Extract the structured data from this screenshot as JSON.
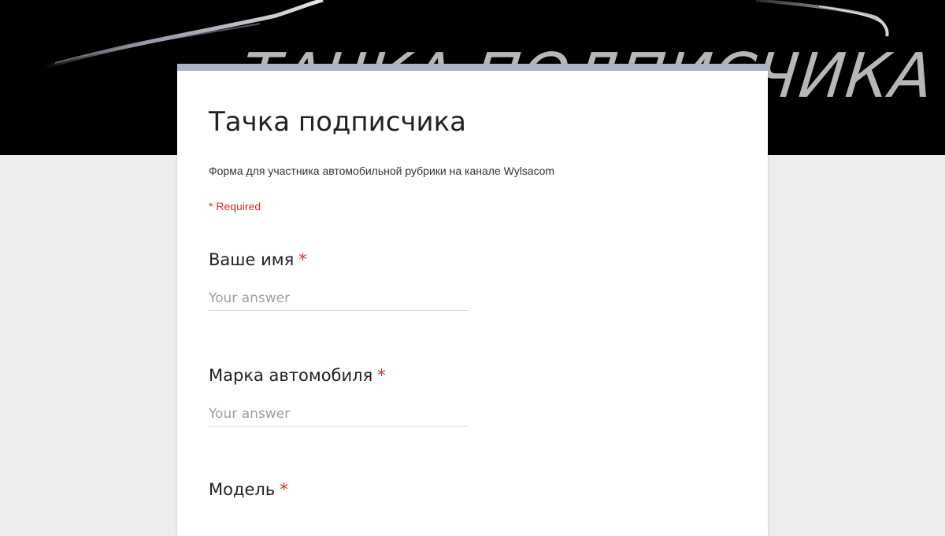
{
  "banner": {
    "text": "ТАЧКА ПОДПИСЧИКА"
  },
  "form": {
    "title": "Тачка подписчика",
    "description": "Форма для участника автомобильной рубрики на канале Wylsacom",
    "required_note": "* Required"
  },
  "questions": [
    {
      "title": "Ваше имя",
      "required_mark": "*",
      "placeholder": "Your answer",
      "value": ""
    },
    {
      "title": "Марка автомобиля",
      "required_mark": "*",
      "placeholder": "Your answer",
      "value": ""
    },
    {
      "title": "Модель",
      "required_mark": "*"
    }
  ],
  "colors": {
    "banner_background": "#000000",
    "page_background": "#ededed",
    "card_accent": "#aab3c8",
    "required_red": "#d93025"
  }
}
